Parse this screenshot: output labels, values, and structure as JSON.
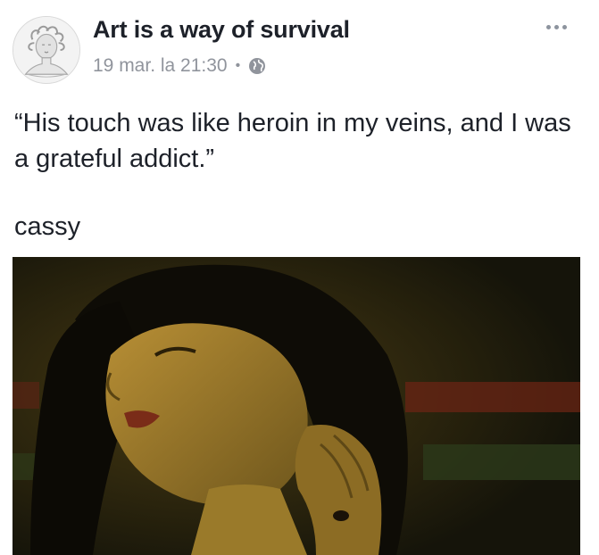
{
  "post": {
    "page_name": "Art is a way of survival",
    "timestamp": "19 mar. la 21:30",
    "separator": "•",
    "audience_icon": "globe-icon",
    "more_icon": "ellipsis-icon",
    "avatar_icon": "medusa-bust-avatar",
    "text": "“His touch was like heroin in my veins, and I was a grateful addict.”",
    "signature": "cassy"
  },
  "colors": {
    "name": "#1d2129",
    "meta": "#90949c",
    "media_bg": "#141208"
  }
}
